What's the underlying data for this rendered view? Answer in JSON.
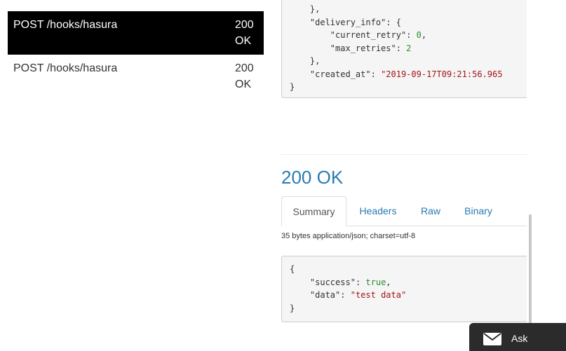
{
  "requests": [
    {
      "method_path": "POST /hooks/hasura",
      "status": "200 OK",
      "active": true
    },
    {
      "method_path": "POST /hooks/hasura",
      "status": "200 OK",
      "active": false
    }
  ],
  "request_body": {
    "lines": [
      "    },",
      "    \"delivery_info\": {",
      "        \"current_retry\": 0,",
      "        \"max_retries\": 2",
      "    },",
      "    \"created_at\": \"2019-09-17T09:21:56.965",
      "}"
    ]
  },
  "response": {
    "status": "200 OK",
    "tabs": [
      "Summary",
      "Headers",
      "Raw",
      "Binary"
    ],
    "active_tab": "Summary",
    "meta": "35 bytes application/json; charset=utf-8",
    "body_lines": [
      "{",
      "    \"success\": true,",
      "    \"data\": \"test data\"",
      "}"
    ]
  },
  "chat_widget": {
    "icon": "mail-icon",
    "label": "Ask"
  },
  "colors": {
    "active_row": "#000000",
    "link": "#2a7bb2",
    "string": "#a31515",
    "number": "#2e8b2e"
  }
}
